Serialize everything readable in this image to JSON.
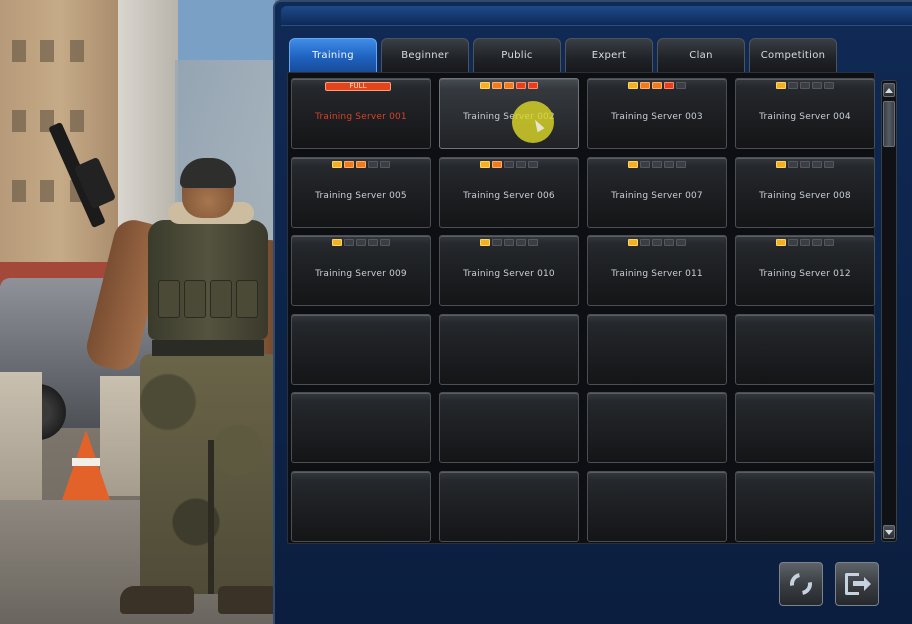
{
  "tabs": [
    {
      "label": "Training",
      "active": true
    },
    {
      "label": "Beginner",
      "active": false
    },
    {
      "label": "Public",
      "active": false
    },
    {
      "label": "Expert",
      "active": false
    },
    {
      "label": "Clan",
      "active": false
    },
    {
      "label": "Competition",
      "active": false
    }
  ],
  "servers": [
    {
      "name": "Training Server 001",
      "status": "full",
      "status_label": "FULL",
      "load": 5,
      "selected": false
    },
    {
      "name": "Training Server 002",
      "status": "open",
      "status_label": "",
      "load": 5,
      "selected": true
    },
    {
      "name": "Training Server 003",
      "status": "open",
      "status_label": "",
      "load": 4,
      "selected": false
    },
    {
      "name": "Training Server 004",
      "status": "open",
      "status_label": "",
      "load": 1,
      "selected": false
    },
    {
      "name": "Training Server 005",
      "status": "open",
      "status_label": "",
      "load": 3,
      "selected": false
    },
    {
      "name": "Training Server 006",
      "status": "open",
      "status_label": "",
      "load": 2,
      "selected": false
    },
    {
      "name": "Training Server 007",
      "status": "open",
      "status_label": "",
      "load": 1,
      "selected": false
    },
    {
      "name": "Training Server 008",
      "status": "open",
      "status_label": "",
      "load": 1,
      "selected": false
    },
    {
      "name": "Training Server 009",
      "status": "open",
      "status_label": "",
      "load": 1,
      "selected": false
    },
    {
      "name": "Training Server 010",
      "status": "open",
      "status_label": "",
      "load": 1,
      "selected": false
    },
    {
      "name": "Training Server 011",
      "status": "open",
      "status_label": "",
      "load": 1,
      "selected": false
    },
    {
      "name": "Training Server 012",
      "status": "open",
      "status_label": "",
      "load": 1,
      "selected": false
    }
  ],
  "empty_slots": 12,
  "load_max": 5,
  "load_colors": [
    "#f3b021",
    "#f07a1e",
    "#f07a1e",
    "#e3401b",
    "#e3401b"
  ],
  "buttons": {
    "refresh_icon": "refresh-icon",
    "exit_icon": "exit-door-icon"
  },
  "colors": {
    "accent_tab": "#1f62c0",
    "full_text": "#d8412a",
    "panel_bg": "#0b1e3f"
  }
}
